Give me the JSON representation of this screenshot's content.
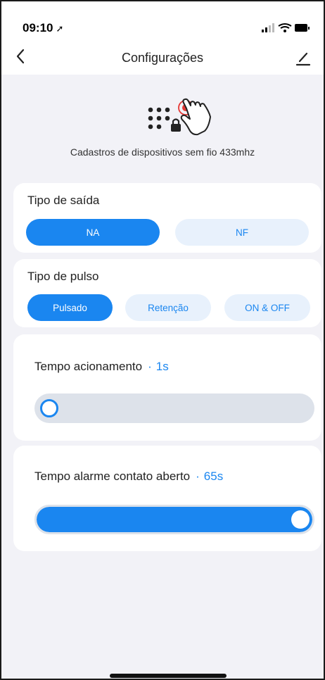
{
  "status_bar": {
    "time": "09:10",
    "location_icon": "location-arrow-icon"
  },
  "nav": {
    "title": "Configurações",
    "back_icon": "chevron-left-icon",
    "edit_icon": "edit-pencil-icon"
  },
  "hero": {
    "icon": "keypad-touch-icon",
    "caption": "Cadastros de dispositivos sem fio 433mhz"
  },
  "output_type": {
    "title": "Tipo de saída",
    "options": [
      "NA",
      "NF"
    ],
    "selected": "NA"
  },
  "pulse_type": {
    "title": "Tipo de pulso",
    "options": [
      "Pulsado",
      "Retenção",
      "ON & OFF"
    ],
    "selected": "Pulsado"
  },
  "activation_time": {
    "label": "Tempo acionamento",
    "separator": "·",
    "value": "1s",
    "level": 0.0
  },
  "open_contact_alarm": {
    "label": "Tempo alarme contato aberto",
    "separator": "·",
    "value": "65s",
    "level": 1.0
  },
  "colors": {
    "accent": "#1a86f0",
    "accent_light": "#e8f1fc",
    "background": "#f2f2f7",
    "track": "#dde2ea"
  }
}
